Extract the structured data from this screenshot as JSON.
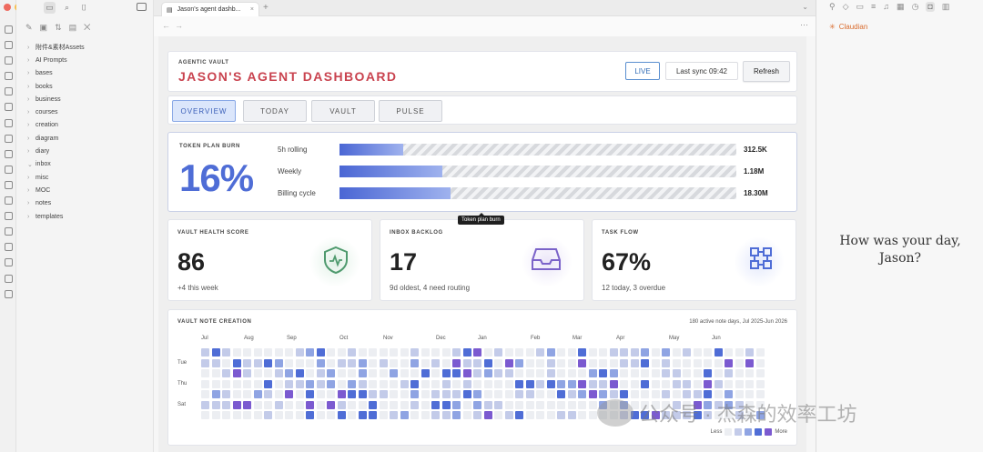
{
  "window": {
    "traffic_lights": [
      "#ee6a5f",
      "#f5be4f",
      "#62c554"
    ]
  },
  "explorer": {
    "folders": [
      "附件&素材Assets",
      "AI Prompts",
      "bases",
      "books",
      "business",
      "courses",
      "creation",
      "diagram",
      "diary",
      "inbox",
      "misc",
      "MOC",
      "notes",
      "templates"
    ]
  },
  "tab": {
    "title": "Jason's agent dashb...",
    "close": "×",
    "new": "+"
  },
  "right_panel": {
    "plugin_name": "Claudian",
    "greeting_line1": "How was your day,",
    "greeting_line2": "Jason?"
  },
  "header": {
    "kicker": "AGENTIC VAULT",
    "title": "JASON'S AGENT DASHBOARD",
    "live_label": "LIVE",
    "sync_label": "Last sync 09:42",
    "refresh_label": "Refresh"
  },
  "dash_tabs": [
    "OVERVIEW",
    "TODAY",
    "VAULT",
    "PULSE"
  ],
  "token_burn": {
    "kicker": "TOKEN PLAN BURN",
    "percent": "16%",
    "rows": [
      {
        "label": "5h rolling",
        "value": "312.5K",
        "fill": 0.16
      },
      {
        "label": "Weekly",
        "value": "1.18M",
        "fill": 0.26
      },
      {
        "label": "Billing cycle",
        "value": "18.30M",
        "fill": 0.28
      }
    ],
    "tooltip": "Token plan burn"
  },
  "stats": [
    {
      "kicker": "VAULT HEALTH SCORE",
      "value": "86",
      "sub": "+4 this week",
      "icon": "shield-pulse-icon",
      "color": "#4f9a6e"
    },
    {
      "kicker": "INBOX BACKLOG",
      "value": "17",
      "sub": "9d oldest, 4 need routing",
      "icon": "inbox-tray-icon",
      "color": "#7b63c9"
    },
    {
      "kicker": "TASK FLOW",
      "value": "67%",
      "sub": "12 today, 3 overdue",
      "icon": "workflow-icon",
      "color": "#4f6dd6"
    }
  ],
  "heatmap": {
    "kicker": "VAULT NOTE CREATION",
    "subtitle": "180 active note days, Jul 2025-Jun 2026",
    "months": [
      "Jul",
      "Aug",
      "Sep",
      "Oct",
      "Nov",
      "Dec",
      "Jan",
      "Feb",
      "Mar",
      "Apr",
      "May",
      "Jun"
    ],
    "days": [
      "Tue",
      "Thu",
      "Sat"
    ],
    "legend_less": "Less",
    "legend_more": "More",
    "colors": [
      "#eceef2",
      "#c3cbe9",
      "#8fa4e3",
      "#4f6dd6",
      "#7b5ad0"
    ]
  },
  "watermark": {
    "text": "公众号 · 杰森的效率工坊"
  }
}
